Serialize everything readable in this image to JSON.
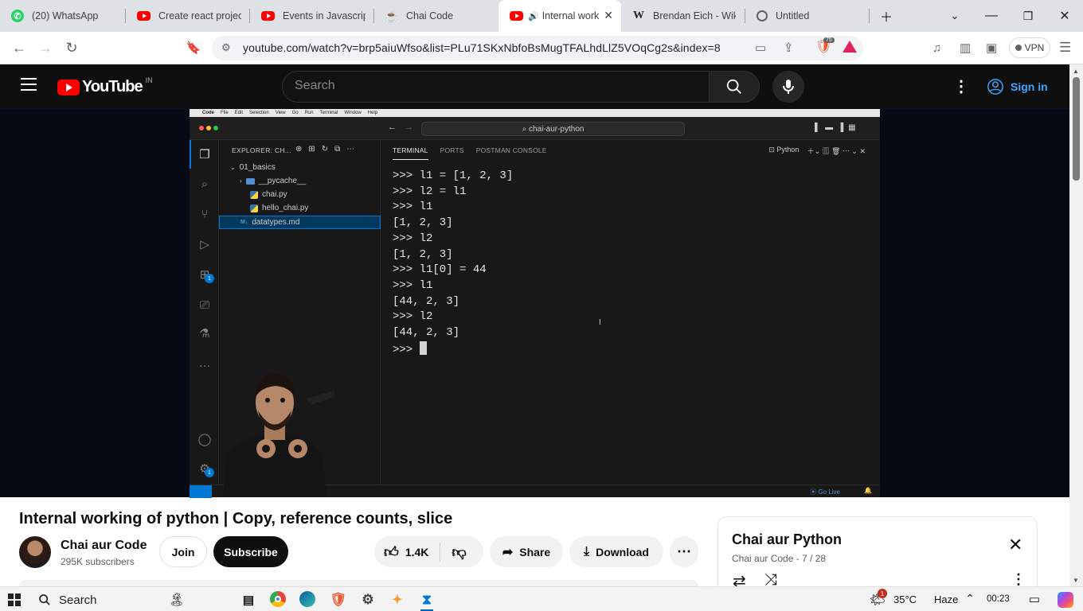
{
  "browser": {
    "tabs": [
      {
        "title": "(20) WhatsApp",
        "icon": "whatsapp-icon"
      },
      {
        "title": "Create react projects",
        "icon": "youtube-icon"
      },
      {
        "title": "Events in Javascript |",
        "icon": "youtube-icon"
      },
      {
        "title": "Chai Code",
        "icon": "chai-icon"
      },
      {
        "title": "Internal work",
        "icon": "youtube-icon",
        "active": true
      },
      {
        "title": "Brendan Eich - Wikip",
        "icon": "wikipedia-icon"
      },
      {
        "title": "Untitled",
        "icon": "globe-icon"
      }
    ],
    "url": "youtube.com/watch?v=brp5aiuWfso&list=PLu71SKxNbfoBsMugTFALhdLlZ5VOqCg2s&index=8",
    "brave_shield_count": "75",
    "vpn_label": "VPN"
  },
  "youtube": {
    "logo_text": "YouTube",
    "country": "IN",
    "search_placeholder": "Search",
    "signin_label": "Sign in",
    "video_title": "Internal working of python | Copy, reference counts, slice",
    "channel_name": "Chai aur Code",
    "subscribers": "295K subscribers",
    "join_label": "Join",
    "subscribe_label": "Subscribe",
    "likes": "1.4K",
    "share_label": "Share",
    "download_label": "Download",
    "playlist": {
      "title": "Chai aur Python",
      "subtitle": "Chai aur Code - 7 / 28"
    }
  },
  "vscode": {
    "mac_menu": [
      "Code",
      "File",
      "Edit",
      "Selection",
      "View",
      "Go",
      "Run",
      "Terminal",
      "Window",
      "Help"
    ],
    "search_text": "chai-aur-python",
    "explorer_title": "EXPLORER: CH...",
    "tree": [
      {
        "name": "01_basics",
        "type": "folder-open"
      },
      {
        "name": "__pycache__",
        "type": "folder"
      },
      {
        "name": "chai.py",
        "type": "python"
      },
      {
        "name": "hello_chai.py",
        "type": "python"
      },
      {
        "name": "datatypes.md",
        "type": "markdown"
      }
    ],
    "panel_tabs": [
      "TERMINAL",
      "PORTS",
      "POSTMAN CONSOLE"
    ],
    "terminal_profile": "Python",
    "terminal_lines": [
      ">>> l1 = [1, 2, 3]",
      ">>> l2 = l1",
      ">>> l1",
      "[1, 2, 3]",
      ">>> l2",
      "[1, 2, 3]",
      ">>> l1[0] = 44",
      ">>> l1",
      "[44, 2, 3]",
      ">>> l2",
      "[44, 2, 3]"
    ],
    "prompt": ">>> ",
    "status_golive": "Go Live",
    "badges": {
      "extensions": "1",
      "settings": "1"
    }
  },
  "taskbar": {
    "search_label": "Search",
    "weather": "35°C",
    "weather_desc": "Haze",
    "time": "00:23",
    "weather_badge": "1"
  }
}
